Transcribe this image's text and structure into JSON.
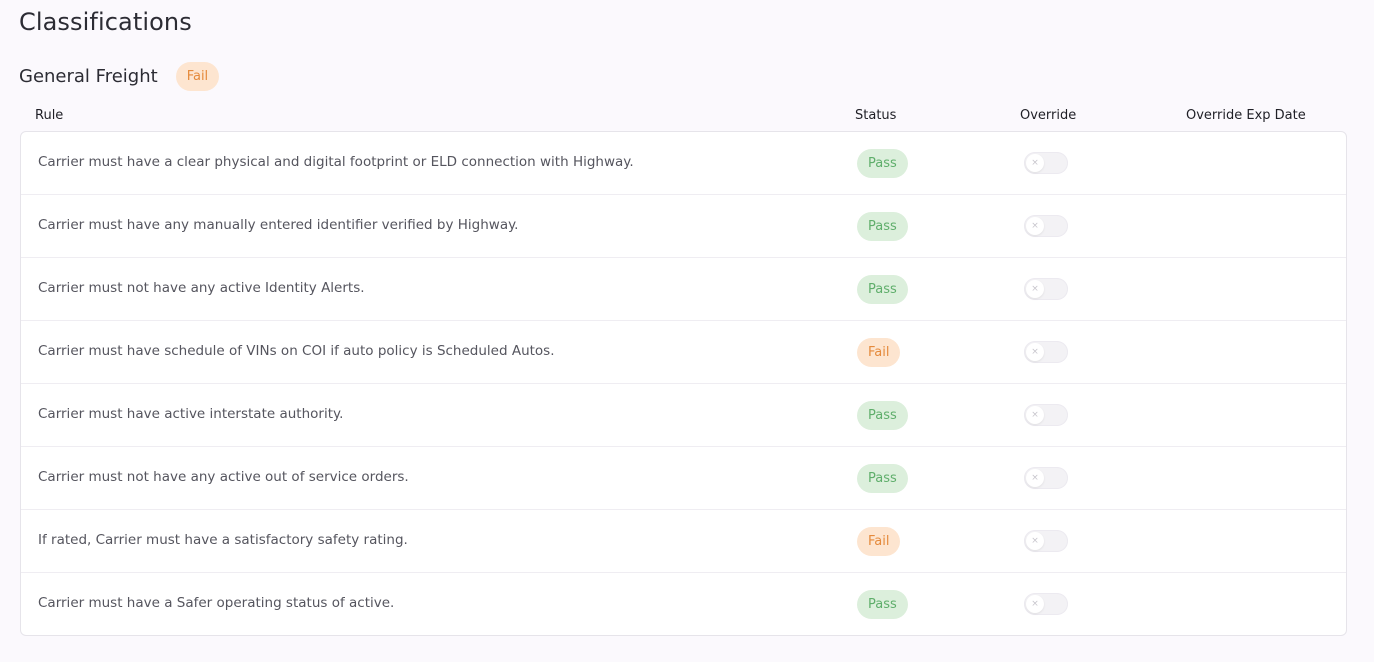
{
  "page": {
    "title": "Classifications"
  },
  "section": {
    "title": "General Freight",
    "status": "Fail"
  },
  "table": {
    "headers": {
      "rule": "Rule",
      "status": "Status",
      "override": "Override",
      "override_exp_date": "Override Exp Date"
    },
    "rows": [
      {
        "rule": "Carrier must have a clear physical and digital footprint or ELD connection with Highway.",
        "status": "Pass",
        "override": false
      },
      {
        "rule": "Carrier must have any manually entered identifier verified by Highway.",
        "status": "Pass",
        "override": false
      },
      {
        "rule": "Carrier must not have any active Identity Alerts.",
        "status": "Pass",
        "override": false
      },
      {
        "rule": "Carrier must have schedule of VINs on COI if auto policy is Scheduled Autos.",
        "status": "Fail",
        "override": false
      },
      {
        "rule": "Carrier must have active interstate authority.",
        "status": "Pass",
        "override": false
      },
      {
        "rule": "Carrier must not have any active out of service orders.",
        "status": "Pass",
        "override": false
      },
      {
        "rule": "If rated, Carrier must have a satisfactory safety rating.",
        "status": "Fail",
        "override": false
      },
      {
        "rule": "Carrier must have a Safer operating status of active.",
        "status": "Pass",
        "override": false
      }
    ]
  },
  "icons": {
    "toggle_knob": "x-icon"
  },
  "colors": {
    "pass_bg": "#dcefdc",
    "pass_text": "#5fae6b",
    "fail_bg": "#fde5d0",
    "fail_text": "#e58a3c"
  }
}
